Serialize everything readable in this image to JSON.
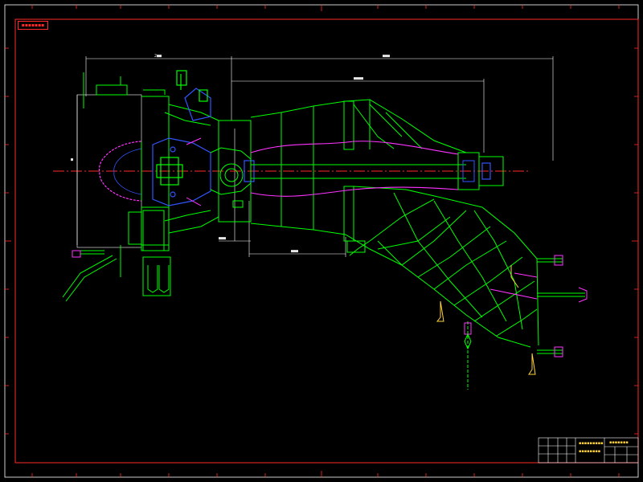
{
  "sheet": {
    "tag_text": "▪▪▪▪▪▪▪",
    "dimension_labels": [
      "2■■",
      "■■■",
      "■■■■",
      "■■■",
      "■",
      "■■■"
    ],
    "title_block": {
      "drawing_title_line1": "▪▪▪▪▪▪▪▪▪",
      "drawing_title_line2": "▪▪▪▪▪▪▪▪",
      "company": "▪▪▪▪▪▪▪"
    }
  },
  "colors": {
    "background": "#000000",
    "border": "#ff2a2a",
    "outline": "#00ff00",
    "liner": "#ff33ff",
    "hub": "#3355ff",
    "dimension": "#ffffff",
    "title_text": "#ffd23c",
    "centerline": "#ff2a2a"
  }
}
